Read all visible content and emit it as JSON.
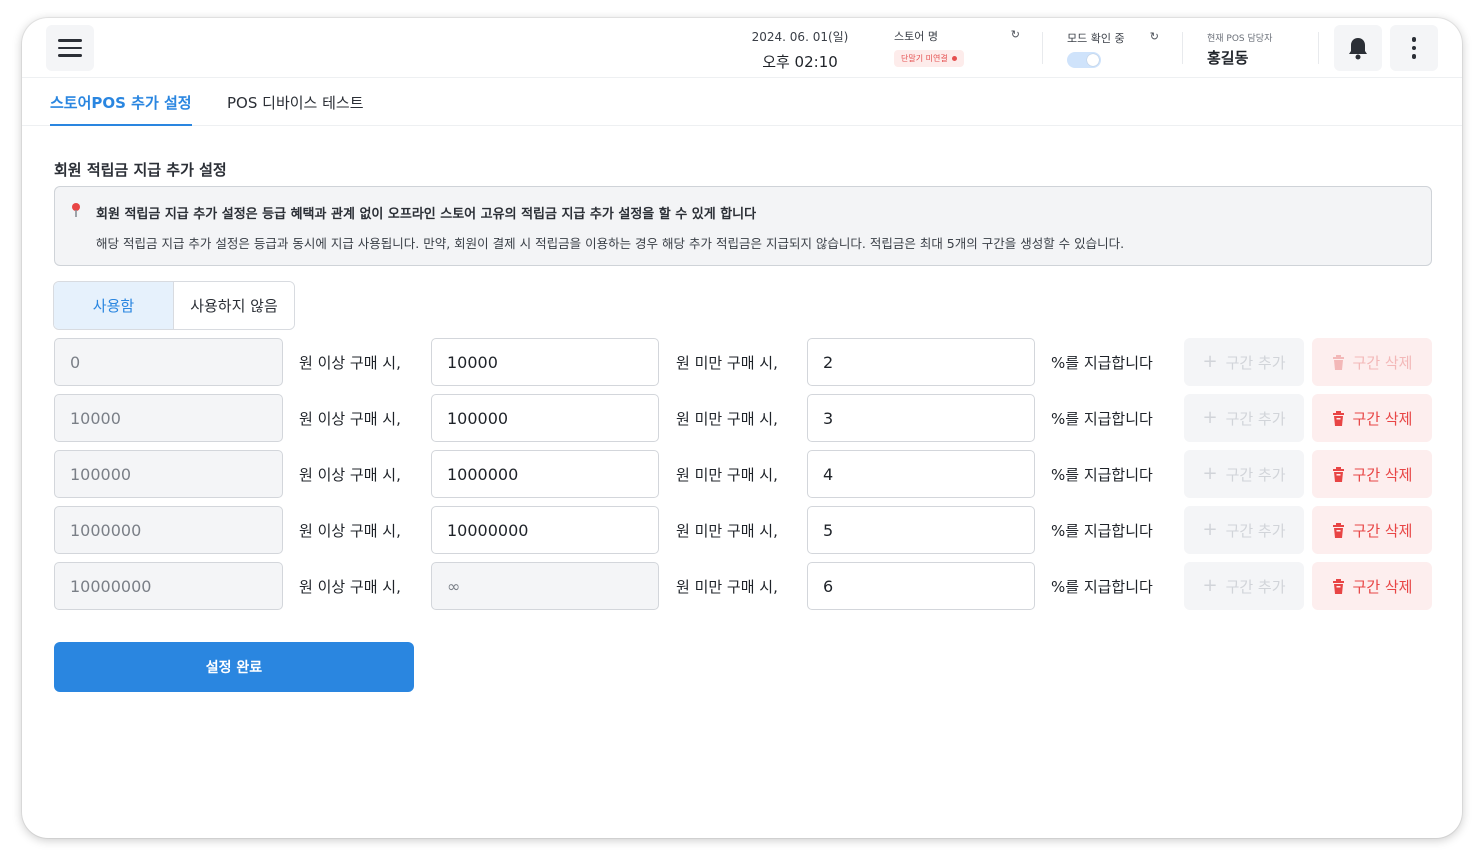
{
  "header": {
    "date": "2024. 06. 01(일)",
    "time": "오후 02:10",
    "store_label": "스토어 명",
    "store_status": "단말기 미연결",
    "mode_label": "모드 확인 중",
    "staff_label": "현재 POS 담당자",
    "staff_name": "홍길동"
  },
  "tabs": [
    {
      "label": "스토어POS 추가 설정",
      "active": true
    },
    {
      "label": "POS 디바이스 테스트",
      "active": false
    }
  ],
  "section": {
    "title": "회원 적립금 지급 추가 설정",
    "notice_title": "회원 적립금 지급 추가 설정은 등급 혜택과 관계 없이 오프라인 스토어 고유의 적립금 지급 추가 설정을 할 수 있게 합니다",
    "notice_body": "해당 적립금 지급 추가 설정은 등급과 동시에 지급 사용됩니다. 만약, 회원이 결제 시 적립금을 이용하는 경우 해당 추가 적립금은 지급되지 않습니다. 적립금은 최대 5개의 구간을 생성할 수 있습니다."
  },
  "toggle": {
    "use_label": "사용함",
    "nouse_label": "사용하지 않음",
    "selected": "사용함"
  },
  "labels": {
    "from_suffix": "원 이상 구매 시,",
    "to_suffix": "원 미만 구매 시,",
    "rate_suffix": "%를 지급합니다",
    "add_button": "구간 추가",
    "delete_button": "구간 삭제"
  },
  "ranges": [
    {
      "from": "0",
      "to": "10000",
      "rate": "2",
      "delete_enabled": false
    },
    {
      "from": "10000",
      "to": "100000",
      "rate": "3",
      "delete_enabled": true
    },
    {
      "from": "100000",
      "to": "1000000",
      "rate": "4",
      "delete_enabled": true
    },
    {
      "from": "1000000",
      "to": "10000000",
      "rate": "5",
      "delete_enabled": true
    },
    {
      "from": "10000000",
      "to": "∞",
      "rate": "6",
      "delete_enabled": true
    }
  ],
  "submit_label": "설정 완료",
  "colors": {
    "accent": "#2a86e0",
    "danger": "#e84545"
  }
}
